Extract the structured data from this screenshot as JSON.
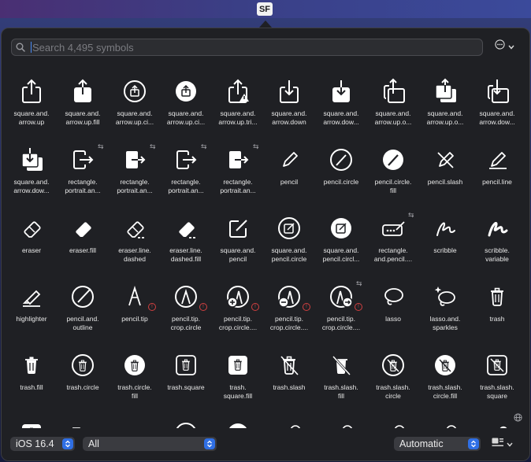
{
  "tray": {
    "label": "SF"
  },
  "search": {
    "placeholder": "Search 4,495 symbols",
    "value": ""
  },
  "symbols": [
    {
      "label": "square.and.\narrow.up",
      "icon": "square-and-arrow-up-icon"
    },
    {
      "label": "square.and.\narrow.up.fill",
      "icon": "square-and-arrow-up-fill-icon"
    },
    {
      "label": "square.and.\narrow.up.ci...",
      "icon": "square-and-arrow-up-circle-icon"
    },
    {
      "label": "square.and.\narrow.up.ci...",
      "icon": "square-and-arrow-up-circle-fill-icon"
    },
    {
      "label": "square.and.\narrow.up.tri...",
      "icon": "square-and-arrow-up-trianglebadge-icon"
    },
    {
      "label": "square.and.\narrow.down",
      "icon": "square-and-arrow-down-icon"
    },
    {
      "label": "square.and.\narrow.dow...",
      "icon": "square-and-arrow-down-fill-icon"
    },
    {
      "label": "square.and.\narrow.up.o...",
      "icon": "square-and-arrow-up-on-square-icon"
    },
    {
      "label": "square.and.\narrow.up.o...",
      "icon": "square-and-arrow-up-on-square-fill-icon"
    },
    {
      "label": "square.and.\narrow.dow...",
      "icon": "square-and-arrow-down-on-square-icon"
    },
    {
      "label": "square.and.\narrow.dow...",
      "icon": "square-and-arrow-down-on-square-fill-icon"
    },
    {
      "label": "rectangle.\nportrait.an...",
      "icon": "rectangle-portrait-and-arrow-right-icon"
    },
    {
      "label": "rectangle.\nportrait.an...",
      "icon": "rectangle-portrait-and-arrow-right-fill-icon"
    },
    {
      "label": "rectangle.\nportrait.an...",
      "icon": "rectangle-portrait-and-arrow-forward-icon"
    },
    {
      "label": "rectangle.\nportrait.an...",
      "icon": "rectangle-portrait-and-arrow-forward-fill-icon"
    },
    {
      "label": "pencil",
      "icon": "pencil-icon"
    },
    {
      "label": "pencil.circle",
      "icon": "pencil-circle-icon"
    },
    {
      "label": "pencil.circle.\nfill",
      "icon": "pencil-circle-fill-icon"
    },
    {
      "label": "pencil.slash",
      "icon": "pencil-slash-icon"
    },
    {
      "label": "pencil.line",
      "icon": "pencil-line-icon"
    },
    {
      "label": "eraser",
      "icon": "eraser-icon"
    },
    {
      "label": "eraser.fill",
      "icon": "eraser-fill-icon"
    },
    {
      "label": "eraser.line.\ndashed",
      "icon": "eraser-line-dashed-icon"
    },
    {
      "label": "eraser.line.\ndashed.fill",
      "icon": "eraser-line-dashed-fill-icon"
    },
    {
      "label": "square.and.\npencil",
      "icon": "square-and-pencil-icon"
    },
    {
      "label": "square.and.\npencil.circle",
      "icon": "square-and-pencil-circle-icon"
    },
    {
      "label": "square.and.\npencil.circl...",
      "icon": "square-and-pencil-circle-fill-icon"
    },
    {
      "label": "rectangle.\nand.pencil....",
      "icon": "rectangle-and-pencil-and-ellipsis-icon"
    },
    {
      "label": "scribble",
      "icon": "scribble-icon"
    },
    {
      "label": "scribble.\nvariable",
      "icon": "scribble-variable-icon"
    },
    {
      "label": "highlighter",
      "icon": "highlighter-icon"
    },
    {
      "label": "pencil.and.\noutline",
      "icon": "pencil-and-outline-icon"
    },
    {
      "label": "pencil.tip",
      "icon": "pencil-tip-icon"
    },
    {
      "label": "pencil.tip.\ncrop.circle",
      "icon": "pencil-tip-crop-circle-icon"
    },
    {
      "label": "pencil.tip.\ncrop.circle....",
      "icon": "pencil-tip-crop-circle-badge-plus-icon"
    },
    {
      "label": "pencil.tip.\ncrop.circle....",
      "icon": "pencil-tip-crop-circle-badge-minus-icon"
    },
    {
      "label": "pencil.tip.\ncrop.circle....",
      "icon": "pencil-tip-crop-circle-badge-arrow-icon"
    },
    {
      "label": "lasso",
      "icon": "lasso-icon"
    },
    {
      "label": "lasso.and.\nsparkles",
      "icon": "lasso-and-sparkles-icon"
    },
    {
      "label": "trash",
      "icon": "trash-icon"
    },
    {
      "label": "trash.fill",
      "icon": "trash-fill-icon"
    },
    {
      "label": "trash.circle",
      "icon": "trash-circle-icon"
    },
    {
      "label": "trash.circle.\nfill",
      "icon": "trash-circle-fill-icon"
    },
    {
      "label": "trash.square",
      "icon": "trash-square-icon"
    },
    {
      "label": "trash.\nsquare.fill",
      "icon": "trash-square-fill-icon"
    },
    {
      "label": "trash.slash",
      "icon": "trash-slash-icon"
    },
    {
      "label": "trash.slash.\nfill",
      "icon": "trash-slash-fill-icon"
    },
    {
      "label": "trash.slash.\ncircle",
      "icon": "trash-slash-circle-icon"
    },
    {
      "label": "trash.slash.\ncircle.fill",
      "icon": "trash-slash-circle-fill-icon"
    },
    {
      "label": "trash.slash.\nsquare",
      "icon": "trash-slash-square-icon"
    }
  ],
  "partial_row_icons": [
    "trash-slash-square-fill-icon",
    "folder-icon",
    "folder-fill-icon",
    "folder-circle-icon",
    "folder-circle-fill-icon",
    "folder-badge-plus-icon",
    "folder-fill-badge-plus-icon",
    "folder-badge-minus-icon",
    "folder-fill-badge-minus-icon",
    "folder-badge-questionmark-icon"
  ],
  "bottombar": {
    "platform": "iOS 16.4",
    "category": "All",
    "rendering": "Automatic"
  },
  "colors": {
    "accent": "#2f6fe5",
    "panel": "#1f2024",
    "warning": "#e04a4a"
  }
}
